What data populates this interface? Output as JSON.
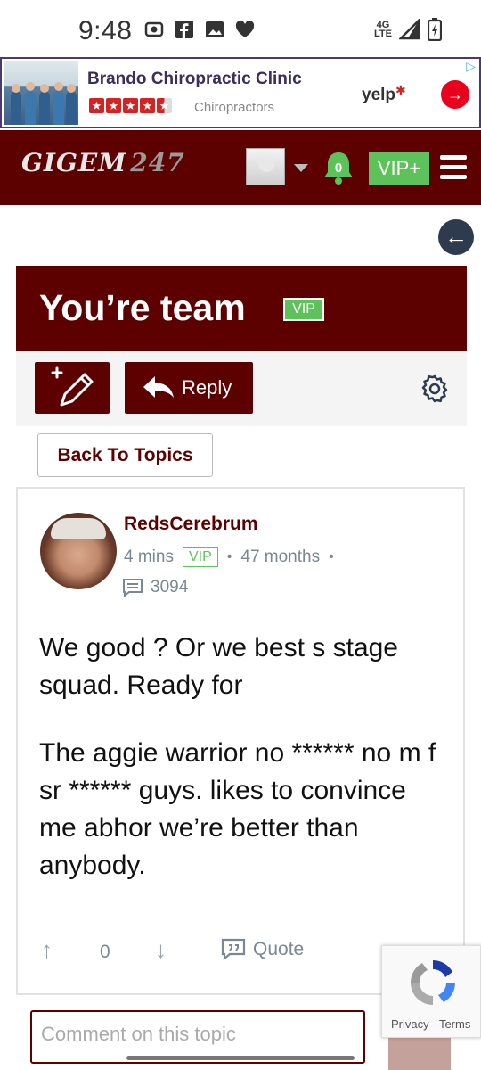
{
  "status_bar": {
    "time": "9:48",
    "icons": [
      "record-icon",
      "facebook-icon",
      "gallery-icon",
      "heart-icon"
    ],
    "network_top": "4G",
    "network_bottom": "LTE",
    "right_icons": [
      "signal-icon",
      "battery-charging-icon"
    ]
  },
  "ad": {
    "title": "Brando Chiropractic Clinic",
    "rating_stars": 4.5,
    "category": "Chiropractors",
    "brand": "yelp",
    "brand_burst": "✱",
    "cta_arrow": "→",
    "ad_choices": "▷"
  },
  "header": {
    "logo_text": "GIGEM",
    "logo_number": "247",
    "notification_count": "0",
    "vip_button": "VIP+"
  },
  "topic": {
    "title": "You’re team",
    "badge": "VIP"
  },
  "toolbar": {
    "reply_label": "Reply",
    "back_to_topics": "Back To Topics"
  },
  "post": {
    "author": "RedsCerebrum",
    "time_ago": "4 mins",
    "badge": "VIP",
    "membership": "47 months",
    "meta_sep": "•",
    "post_count": "3094",
    "body": [
      "We good ? Or we best s stage squad. Ready for",
      "The aggie warrior no ****** no m f sr ****** guys. likes to convince me abhor we’re better than anybody."
    ],
    "vote_count": "0",
    "quote_label": "Quote"
  },
  "comment": {
    "placeholder": "Comment on this topic"
  },
  "recaptcha": {
    "privacy": "Privacy",
    "sep": " - ",
    "terms": "Terms"
  },
  "colors": {
    "brand_maroon": "#5c0000",
    "vip_green": "#5ec25a",
    "meta_gray": "#7b8794"
  }
}
